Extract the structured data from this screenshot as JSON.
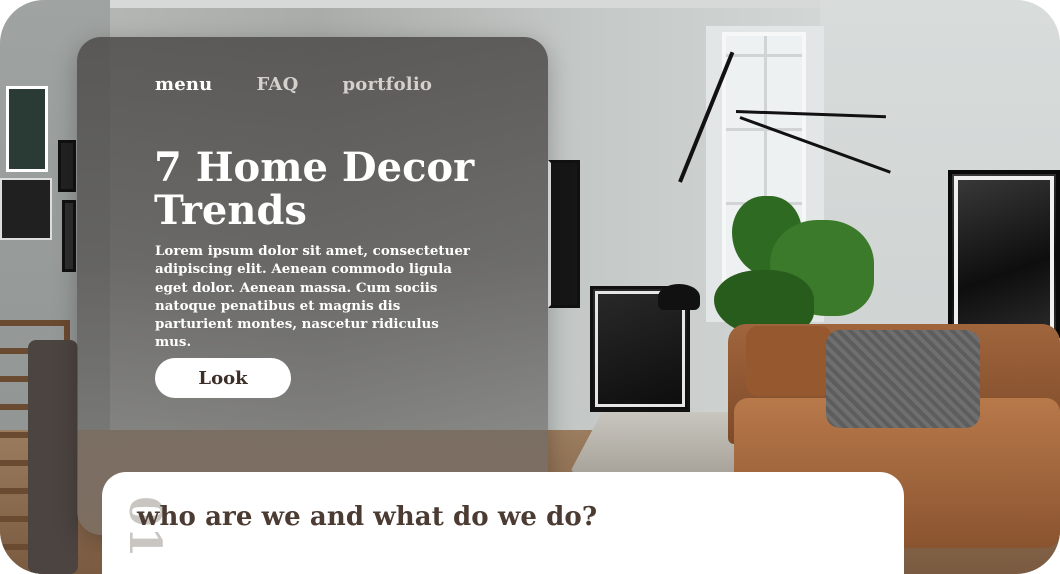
{
  "nav": {
    "items": [
      {
        "label": "menu"
      },
      {
        "label": "FAQ"
      },
      {
        "label": "portfolio"
      }
    ]
  },
  "hero": {
    "headline": "7 Home Decor Trends",
    "body": "Lorem ipsum dolor sit amet, consectetuer adipiscing elit. Aenean commodo ligula eget dolor. Aenean massa. Cum sociis natoque penatibus et magnis dis parturient montes, nascetur ridiculus mus.",
    "cta_label": "Look"
  },
  "section": {
    "number": "01",
    "title": "who are we and what do we do?"
  },
  "colors": {
    "text_dark": "#4b3b32",
    "button_bg": "#ffffff",
    "nav_active": "#ffffff",
    "nav_muted": "#d4d1cd"
  }
}
